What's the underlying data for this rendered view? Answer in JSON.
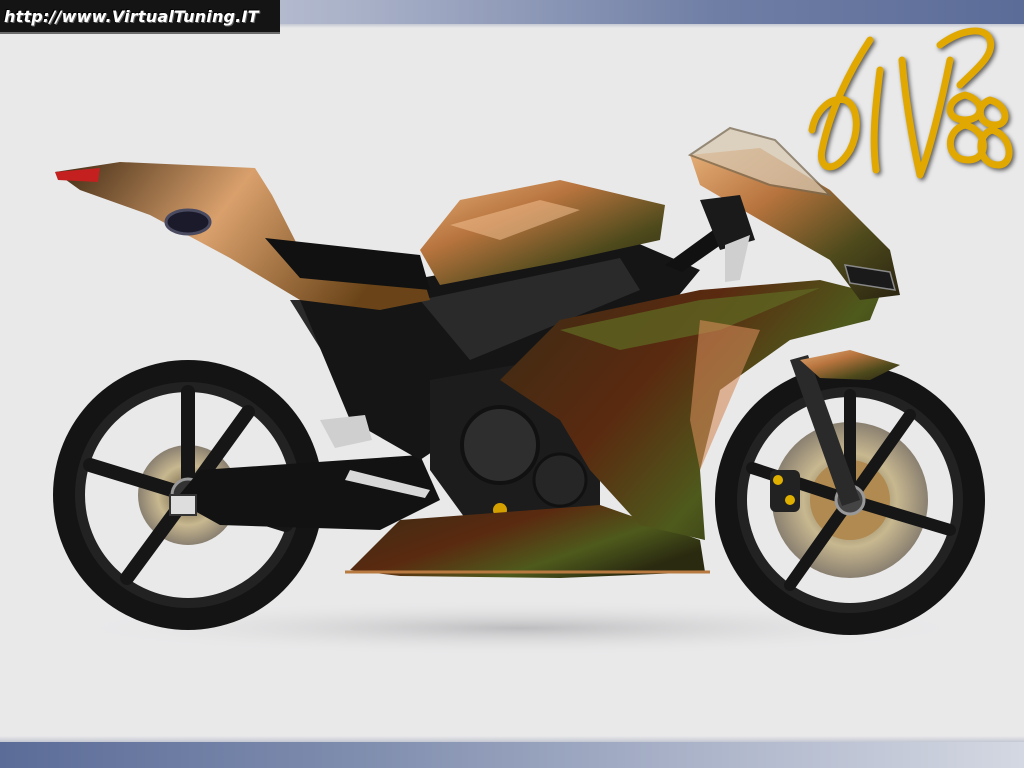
{
  "watermark": {
    "url": "http://www.VirtualTuning.IT"
  },
  "signature": {
    "text": "dill88",
    "color": "#e0a800"
  },
  "colors": {
    "paint_bronze": "#b8743e",
    "paint_green": "#4e4a1c",
    "frame_black": "#151515",
    "background": "#e9e9ea",
    "bar_blue": "#5b6c98"
  }
}
